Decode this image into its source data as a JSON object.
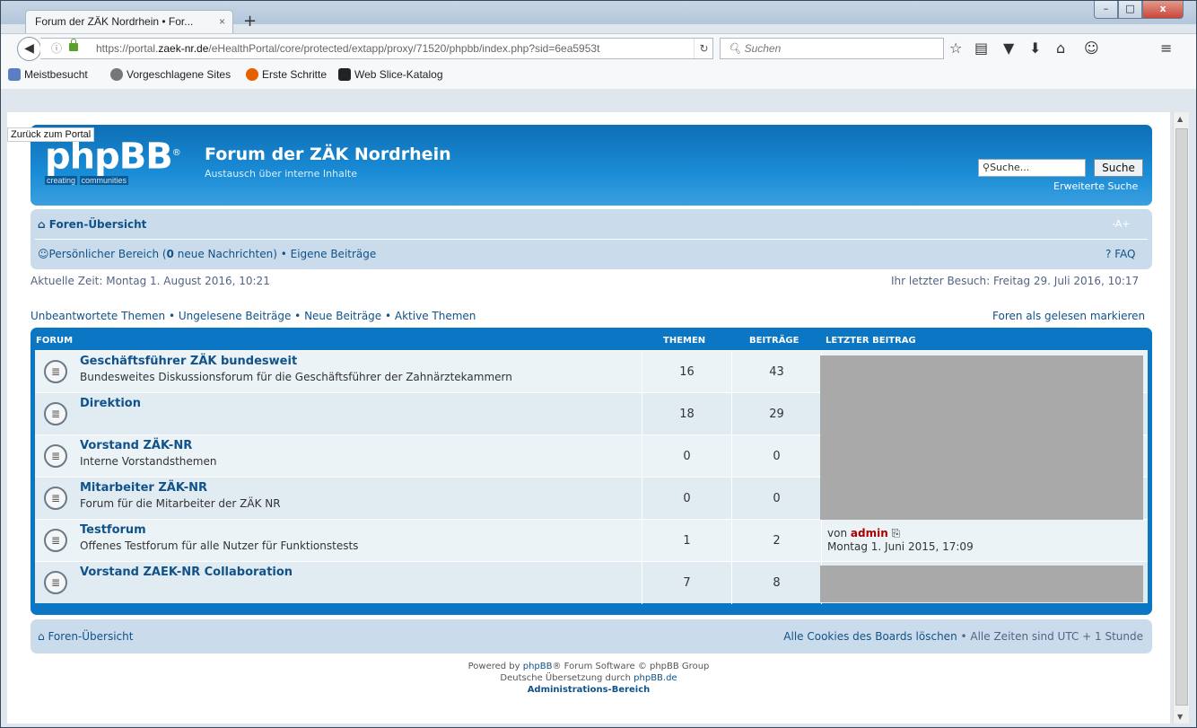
{
  "browser": {
    "tab_title": "Forum der ZÄK Nordrhein • For...",
    "tab_close": "×",
    "new_tab": "+",
    "win_min": "–",
    "win_max": "□",
    "win_close": "x",
    "url_prefix": "https://portal.",
    "url_domain": "zaek-nr.de",
    "url_rest": "/eHealthPortal/core/protected/extapp/proxy/71520/phpbb/index.php?sid=6ea5953t",
    "search_placeholder": "Suchen",
    "bookmarks": [
      "Meistbesucht",
      "Vorgeschlagene Sites",
      "Erste Schritte",
      "Web Slice-Katalog"
    ]
  },
  "page": {
    "back_to_portal": "Zurück zum Portal",
    "logo_text": "phpBB",
    "logo_reg": "®",
    "logo_tag1": "creating",
    "logo_tag2": "communities",
    "site_title": "Forum der ZÄK Nordrhein",
    "site_subtitle": "Austausch über interne Inhalte",
    "search_value": "Suche...",
    "search_button": "Suche",
    "advanced_search": "Erweiterte Suche",
    "nav_home": "Foren-Übersicht",
    "font_size": "-A+",
    "ucp_before": "Persönlicher Bereich (",
    "ucp_count": "0",
    "ucp_after": " neue Nachrichten)",
    "own_posts": "Eigene Beiträge",
    "faq": "FAQ",
    "current_time": "Aktuelle Zeit: Montag 1. August 2016, 10:21",
    "last_visit": "Ihr letzter Besuch: Freitag 29. Juli 2016, 10:17",
    "quick_links": [
      "Unbeantwortete Themen",
      "Ungelesene Beiträge",
      "Neue Beiträge",
      "Aktive Themen"
    ],
    "mark_read": "Foren als gelesen markieren",
    "columns": {
      "forum": "Forum",
      "topics": "Themen",
      "posts": "Beiträge",
      "last": "Letzter Beitrag"
    },
    "forums": [
      {
        "title": "Geschäftsführer ZÄK bundesweit",
        "desc": "Bundesweites Diskussionsforum für die Geschäftsführer der Zahnärztekammern",
        "topics": "16",
        "posts": "43"
      },
      {
        "title": "Direktion",
        "desc": "",
        "topics": "18",
        "posts": "29"
      },
      {
        "title": "Vorstand ZÄK-NR",
        "desc": "Interne Vorstandsthemen",
        "topics": "0",
        "posts": "0"
      },
      {
        "title": "Mitarbeiter ZÄK-NR",
        "desc": "Forum für die Mitarbeiter der ZÄK NR",
        "topics": "0",
        "posts": "0"
      },
      {
        "title": "Testforum",
        "desc": "Offenes Testforum für alle Nutzer für Funktionstests",
        "topics": "1",
        "posts": "2"
      },
      {
        "title": "Vorstand ZAEK-NR Collaboration",
        "desc": "",
        "topics": "7",
        "posts": "8"
      }
    ],
    "last_post_by": "von",
    "last_post_author": "admin",
    "last_post_date": "Montag 1. Juni 2015, 17:09",
    "footer_home": "Foren-Übersicht",
    "delete_cookies": "Alle Cookies des Boards löschen",
    "timezone": "Alle Zeiten sind UTC + 1 Stunde",
    "powered_by_1": "Powered by ",
    "powered_by_link": "phpBB",
    "powered_by_2": "® Forum Software © phpBB Group",
    "translation_1": "Deutsche Übersetzung durch ",
    "translation_link": "phpBB.de",
    "admin_link": "Administrations-Bereich"
  },
  "colors": {
    "header": "#0e6fb6",
    "link": "#105289",
    "navbox": "#cadceb",
    "author": "#aa0000"
  }
}
